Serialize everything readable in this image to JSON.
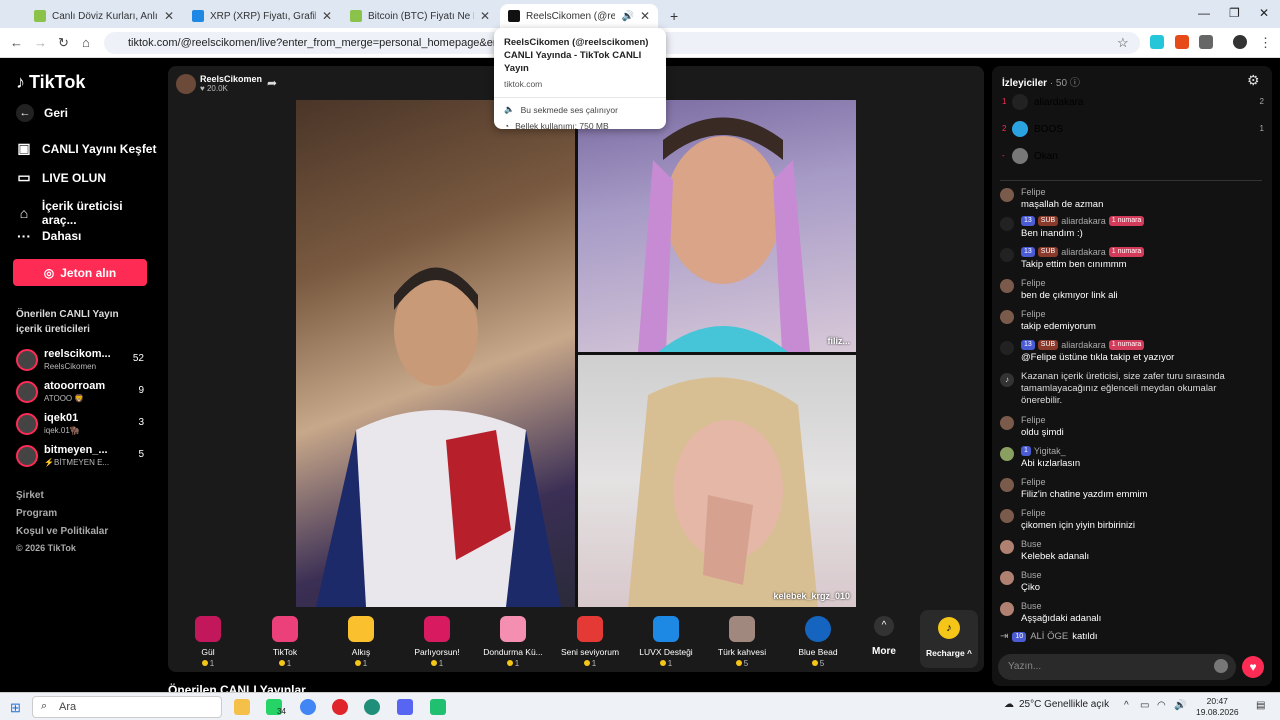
{
  "browser": {
    "tabs": [
      {
        "title": "Canlı Döviz Kurları, Anlık Altın F",
        "icon_color": "#8bc34a"
      },
      {
        "title": "XRP (XRP) Fiyatı, Grafikler, Piyas",
        "icon_color": "#1e88e5"
      },
      {
        "title": "Bitcoin (BTC) Fiyatı Ne Kadar? C",
        "icon_color": "#8bc34a"
      },
      {
        "title": "ReelsCikomen (@reelscikom",
        "icon_color": "#111111"
      }
    ],
    "new_tab": "+",
    "url": "tiktok.com/@reelscikomen/live?enter_from_merge=personal_homepage&enter_method=",
    "window_controls": {
      "minimize": "—",
      "maximize": "❐",
      "close": "✕"
    }
  },
  "tooltip": {
    "title": "ReelsCikomen (@reelscikomen) CANLI Yayında - TikTok CANLI Yayın",
    "domain": "tiktok.com",
    "audio": "Bu sekmede ses çalınıyor",
    "memory": "Bellek kullanımı: 750 MB"
  },
  "sidebar": {
    "logo": "TikTok",
    "back": "Geri",
    "nav": [
      {
        "label": "CANLI Yayını Keşfet",
        "icon": "live-explore-icon"
      },
      {
        "label": "LIVE OLUN",
        "icon": "camera-icon"
      },
      {
        "label": "İçerik üreticisi araç...",
        "icon": "creator-tools-icon"
      },
      {
        "label": "Dahası",
        "icon": "more-dots-icon"
      }
    ],
    "coin_button": "Jeton alın",
    "suggested_title": "Önerilen CANLI Yayın içerik üreticileri",
    "suggested": [
      {
        "name": "reelscikom...",
        "sub": "ReelsCikomen",
        "count": "52"
      },
      {
        "name": "atooorroam",
        "sub": "ATOOO 🦁",
        "count": "9"
      },
      {
        "name": "iqek01",
        "sub": "iqek.01🦬",
        "count": "3"
      },
      {
        "name": "bitmeyen_...",
        "sub": "⚡BİTMEYEN E...",
        "count": "5"
      }
    ],
    "footer": [
      "Şirket",
      "Program",
      "Koşul ve Politikalar"
    ],
    "copyright": "© 2026 TikTok"
  },
  "stream": {
    "host_name": "ReelsCikomen",
    "likes": "♥ 20.0K",
    "guest_labels": [
      "filiz...",
      "kelebek_krgz_010"
    ]
  },
  "gifts": [
    {
      "name": "Gül",
      "price": "1",
      "color": "#c2185b"
    },
    {
      "name": "TikTok",
      "price": "1",
      "color": "#ec407a"
    },
    {
      "name": "Alkış",
      "price": "1",
      "color": "#fbc02d"
    },
    {
      "name": "Parlıyorsun!",
      "price": "1",
      "color": "#d81b60"
    },
    {
      "name": "Dondurma Kü...",
      "price": "1",
      "color": "#f48fb1"
    },
    {
      "name": "Seni seviyorum",
      "price": "1",
      "color": "#e53935"
    },
    {
      "name": "LUVX Desteği",
      "price": "1",
      "color": "#1e88e5"
    },
    {
      "name": "Türk kahvesi",
      "price": "5",
      "color": "#a1887f"
    },
    {
      "name": "Blue Bead",
      "price": "5",
      "color": "#1565c0"
    }
  ],
  "more": "More",
  "recharge": "Recharge ^",
  "suggested_section": "Önerilen CANLI Yayınlar",
  "chat": {
    "viewers_label": "İzleyiciler",
    "viewers_count": "· 50",
    "top_viewers": [
      {
        "rank": "1",
        "name": "aliardakara",
        "score": "2"
      },
      {
        "rank": "2",
        "name": "BOOS",
        "score": "1"
      },
      {
        "rank": "-",
        "name": "Okan",
        "score": ""
      }
    ],
    "messages": [
      {
        "user": "Felipe",
        "text": "maşallah de azman",
        "level": "",
        "sub": false,
        "rank": ""
      },
      {
        "user": "aliardakara",
        "text": "Ben inandım :)",
        "level": "13",
        "sub": true,
        "rank": "1 numara"
      },
      {
        "user": "aliardakara",
        "text": "Takip ettim ben cınımmm",
        "level": "13",
        "sub": true,
        "rank": "1 numara"
      },
      {
        "user": "Felipe",
        "text": "ben de çıkmıyor link ali",
        "level": "",
        "sub": false,
        "rank": ""
      },
      {
        "user": "Felipe",
        "text": "takip edemiyorum",
        "level": "",
        "sub": false,
        "rank": ""
      },
      {
        "user": "aliardakara",
        "text": "@Felipe üstüne tıkla takip et yazıyor",
        "level": "13",
        "sub": true,
        "rank": "1 numara"
      }
    ],
    "system_message": "Kazanan içerik üreticisi, size zafer turu sırasında tamamlayacağınız eğlenceli meydan okumalar önerebilir.",
    "messages2": [
      {
        "user": "Felipe",
        "text": "oldu şimdi",
        "level": ""
      },
      {
        "user": "Yigitak_",
        "text": "Abi kızlarlasın",
        "level": "1"
      },
      {
        "user": "Felipe",
        "text": "Filiz'in chatine yazdım emmim",
        "level": ""
      },
      {
        "user": "Felipe",
        "text": "çikomen için yiyin birbirinizi",
        "level": ""
      },
      {
        "user": "Buse",
        "text": "Kelebek adanalı",
        "level": ""
      },
      {
        "user": "Buse",
        "text": "Çiko",
        "level": ""
      },
      {
        "user": "Buse",
        "text": "Aşşağıdaki adanalı",
        "level": ""
      }
    ],
    "join": {
      "level": "10",
      "user": "ALİ ÖGE",
      "text": "katıldı"
    },
    "input_placeholder": "Yazın..."
  },
  "taskbar": {
    "search": "Ara",
    "whatsapp_badge": "34",
    "weather": "25°C  Genellikle açık",
    "time": "20:47",
    "date": "19.08.2026"
  }
}
